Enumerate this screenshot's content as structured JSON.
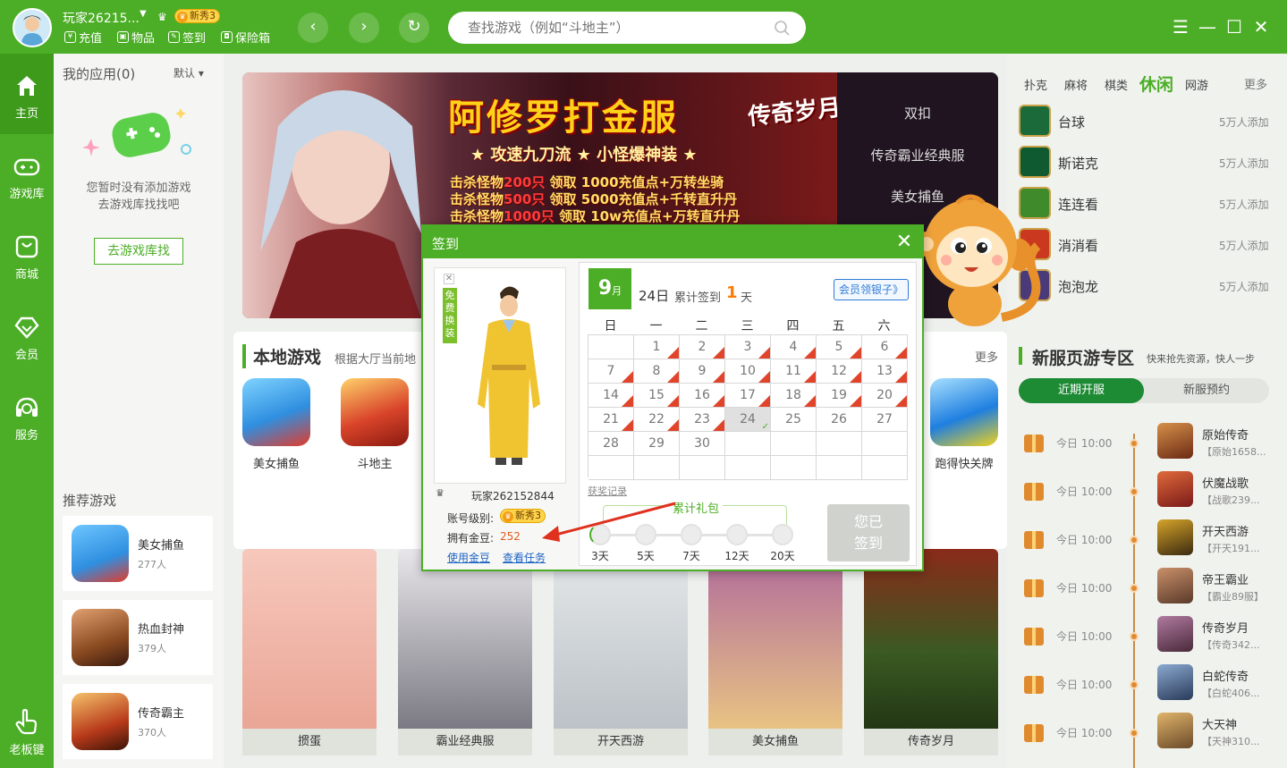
{
  "header": {
    "username": "玩家26215...",
    "badge": "新秀3",
    "links": [
      "充值",
      "物品",
      "签到",
      "保险箱"
    ],
    "search_placeholder": "查找游戏（例如“斗地主”）"
  },
  "sidebar": {
    "items": [
      {
        "label": "主页",
        "icon": "home-icon"
      },
      {
        "label": "游戏库",
        "icon": "gamepad-icon"
      },
      {
        "label": "商城",
        "icon": "shop-icon"
      },
      {
        "label": "会员",
        "icon": "diamond-icon"
      },
      {
        "label": "服务",
        "icon": "headset-icon"
      }
    ],
    "boss_key": "老板键"
  },
  "my_apps": {
    "title": "我的应用(0)",
    "sort": "默认",
    "empty_line1": "您暂时没有添加游戏",
    "empty_line2": "去游戏库找找吧",
    "goto_button": "去游戏库找"
  },
  "recommended": {
    "title": "推荐游戏",
    "items": [
      {
        "name": "美女捕鱼",
        "count": "277人",
        "color": "#2f8fe0"
      },
      {
        "name": "热血封神",
        "count": "379人",
        "color": "#8a4a20"
      },
      {
        "name": "传奇霸主",
        "count": "370人",
        "color": "#b83a1a"
      }
    ]
  },
  "banner": {
    "title": "阿修罗打金服",
    "subtitle": "★ 攻速九刀流 ★ 小怪爆神装 ★",
    "lines": [
      {
        "a": "击杀怪物",
        "b": "200只",
        "c": " 领取 1000充值点+万转坐骑"
      },
      {
        "a": "击杀怪物",
        "b": "500只",
        "c": " 领取  5000充值点+千转直升丹"
      },
      {
        "a": "击杀怪物",
        "b": "1000只",
        "c": " 领取 10w充值点+万转直升丹"
      }
    ],
    "logo": "传奇岁月",
    "list": [
      "双扣",
      "传奇霸业经典服",
      "美女捕鱼"
    ]
  },
  "local_games": {
    "title": "本地游戏",
    "desc": "根据大厅当前地",
    "more": "更多",
    "items": [
      {
        "name": "美女捕鱼",
        "color": "#2f8fe0"
      },
      {
        "name": "斗地主",
        "color": "#d9442a"
      },
      {
        "name": "跑得快关牌",
        "color": "#1f7fe0"
      }
    ]
  },
  "bottom_cards": [
    {
      "name": "掼蛋",
      "color": "#e8b4a8"
    },
    {
      "name": "霸业经典服",
      "color": "#6b6a74"
    },
    {
      "name": "开天西游",
      "color": "#cfd3d6"
    },
    {
      "name": "美女捕鱼",
      "color": "#c98ab0"
    },
    {
      "name": "传奇岁月",
      "color": "#3a5a22"
    }
  ],
  "right": {
    "categories": [
      "扑克",
      "麻将",
      "棋类",
      "休闲",
      "网游"
    ],
    "active_category": "休闲",
    "more": "更多",
    "games": [
      {
        "name": "台球",
        "count": "5万人添加",
        "color": "#1b6b3a"
      },
      {
        "name": "斯诺克",
        "count": "5万人添加",
        "color": "#0f5a30"
      },
      {
        "name": "连连看",
        "count": "5万人添加",
        "color": "#3f8a2a"
      },
      {
        "name": "消消看",
        "count": "5万人添加",
        "color": "#c9381f"
      },
      {
        "name": "泡泡龙",
        "count": "5万人添加",
        "color": "#4a3a7a"
      }
    ],
    "server_title": "新服页游专区",
    "server_desc": "快来抢先资源，快人一步",
    "tab_recent": "近期开服",
    "tab_reserve": "新服预约",
    "servers": [
      {
        "time": "今日 10:00",
        "name": "原始传奇",
        "sub": "【原始1658...",
        "color": "#6b2a14"
      },
      {
        "time": "今日 10:00",
        "name": "伏魔战歌",
        "sub": "【战歌239...",
        "color": "#7a1a1a"
      },
      {
        "time": "今日 10:00",
        "name": "开天西游",
        "sub": "【开天191...",
        "color": "#3a2a10"
      },
      {
        "time": "今日 10:00",
        "name": "帝王霸业",
        "sub": "【霸业89服】",
        "color": "#5a3a2a"
      },
      {
        "time": "今日 10:00",
        "name": "传奇岁月",
        "sub": "【传奇342...",
        "color": "#4a2a3a"
      },
      {
        "time": "今日 10:00",
        "name": "白蛇传奇",
        "sub": "【白蛇406...",
        "color": "#2a3a5a"
      },
      {
        "time": "今日 10:00",
        "name": "大天神",
        "sub": "【天神310...",
        "color": "#6a4a2a"
      }
    ]
  },
  "dialog": {
    "title": "签到",
    "free_tag": "免费换装",
    "user": "玩家262152844",
    "level_label": "账号级别:",
    "beans_label": "拥有金豆:",
    "beans": "252",
    "use_beans": "使用金豆",
    "view_tasks": "查看任务",
    "month": "9",
    "month_unit": "月",
    "day_label": "24日",
    "acc_label": "累计签到",
    "acc_count": "1",
    "acc_unit": "天",
    "member_btn": "会员领银子》",
    "weekdays": [
      "日",
      "一",
      "二",
      "三",
      "四",
      "五",
      "六"
    ],
    "reward_record": "获奖记录",
    "acc_gift": "累计礼包",
    "milestones": [
      "3天",
      "5天",
      "7天",
      "12天",
      "20天"
    ],
    "signed_btn_1": "您已",
    "signed_btn_2": "签到",
    "today": 24
  }
}
